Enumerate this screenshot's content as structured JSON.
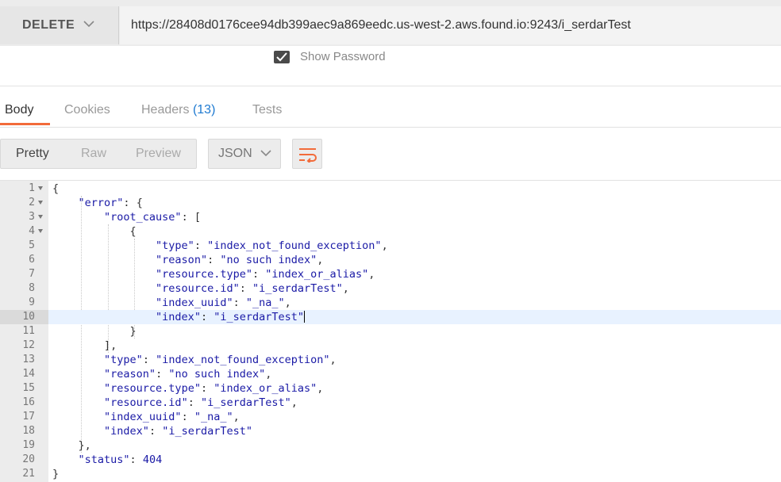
{
  "request": {
    "method": "DELETE",
    "url": "https://28408d0176cee94db399aec9a869eedc.us-west-2.aws.found.io:9243/i_serdarTest"
  },
  "auth": {
    "show_password_label": "Show Password",
    "show_password_checked": true
  },
  "response_tabs": {
    "body": "Body",
    "cookies": "Cookies",
    "headers": "Headers",
    "headers_count": "(13)",
    "tests": "Tests",
    "active": "Body"
  },
  "toolbar": {
    "pretty": "Pretty",
    "raw": "Raw",
    "preview": "Preview",
    "format": "JSON",
    "wrap_icon": "wrap-lines-icon"
  },
  "editor": {
    "highlighted_line": 10,
    "lines": [
      {
        "n": "1",
        "fold": true,
        "text": "{"
      },
      {
        "n": "2",
        "fold": true,
        "text": "    \"error\": {"
      },
      {
        "n": "3",
        "fold": true,
        "text": "        \"root_cause\": ["
      },
      {
        "n": "4",
        "fold": true,
        "text": "            {"
      },
      {
        "n": "5",
        "fold": false,
        "text": "                \"type\": \"index_not_found_exception\","
      },
      {
        "n": "6",
        "fold": false,
        "text": "                \"reason\": \"no such index\","
      },
      {
        "n": "7",
        "fold": false,
        "text": "                \"resource.type\": \"index_or_alias\","
      },
      {
        "n": "8",
        "fold": false,
        "text": "                \"resource.id\": \"i_serdarTest\","
      },
      {
        "n": "9",
        "fold": false,
        "text": "                \"index_uuid\": \"_na_\","
      },
      {
        "n": "10",
        "fold": false,
        "text": "                \"index\": \"i_serdarTest\""
      },
      {
        "n": "11",
        "fold": false,
        "text": "            }"
      },
      {
        "n": "12",
        "fold": false,
        "text": "        ],"
      },
      {
        "n": "13",
        "fold": false,
        "text": "        \"type\": \"index_not_found_exception\","
      },
      {
        "n": "14",
        "fold": false,
        "text": "        \"reason\": \"no such index\","
      },
      {
        "n": "15",
        "fold": false,
        "text": "        \"resource.type\": \"index_or_alias\","
      },
      {
        "n": "16",
        "fold": false,
        "text": "        \"resource.id\": \"i_serdarTest\","
      },
      {
        "n": "17",
        "fold": false,
        "text": "        \"index_uuid\": \"_na_\","
      },
      {
        "n": "18",
        "fold": false,
        "text": "        \"index\": \"i_serdarTest\""
      },
      {
        "n": "19",
        "fold": false,
        "text": "    },"
      },
      {
        "n": "20",
        "fold": false,
        "text": "    \"status\": 404"
      },
      {
        "n": "21",
        "fold": false,
        "text": "}"
      }
    ]
  }
}
